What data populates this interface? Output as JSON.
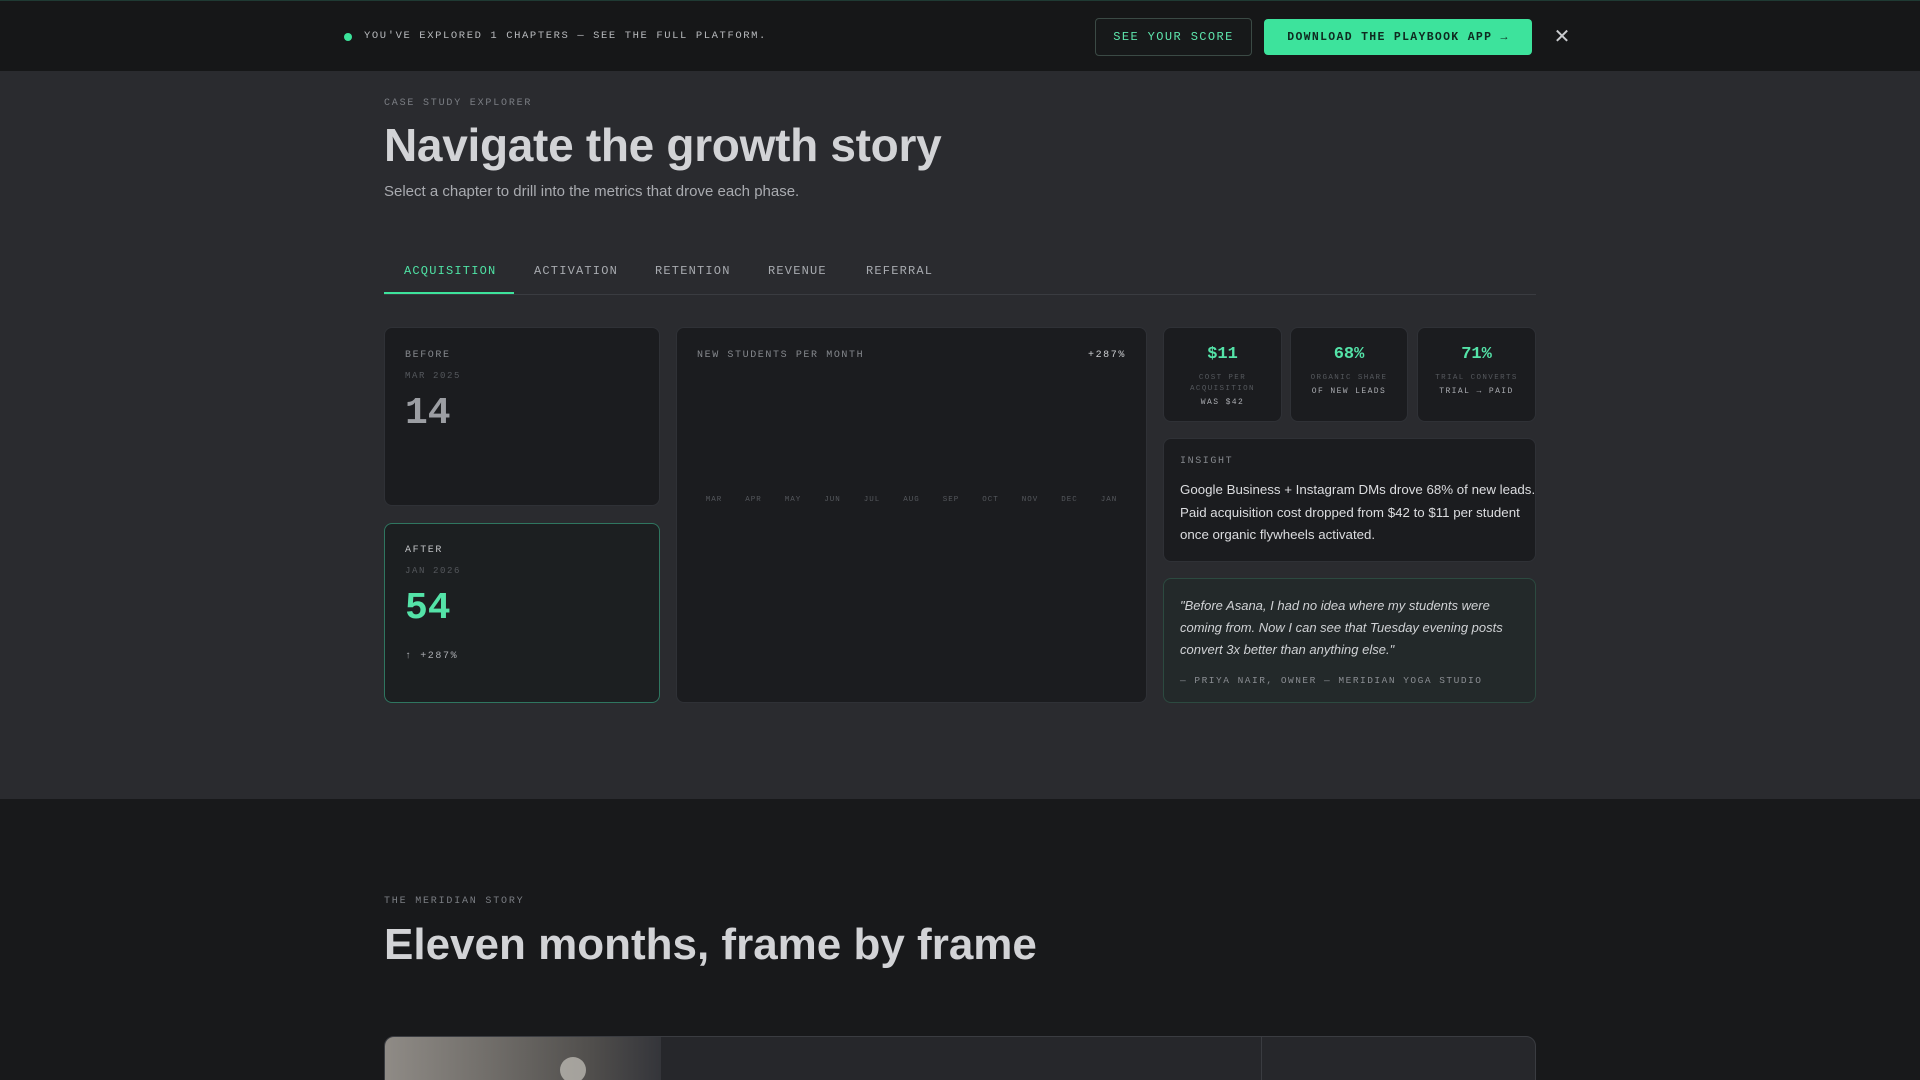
{
  "banner": {
    "message": "YOU'VE EXPLORED 1 CHAPTERS — SEE THE FULL PLATFORM.",
    "score_button": "SEE YOUR SCORE",
    "download_button": "DOWNLOAD THE PLAYBOOK APP →",
    "close_icon": "close-icon",
    "close_glyph": "✕"
  },
  "header": {
    "eyebrow": "CASE STUDY EXPLORER",
    "title": "Navigate the growth story",
    "subtitle": "Select a chapter to drill into the metrics that drove each phase."
  },
  "tabs": [
    {
      "label": "ACQUISITION",
      "active": true
    },
    {
      "label": "ACTIVATION",
      "active": false
    },
    {
      "label": "RETENTION",
      "active": false
    },
    {
      "label": "REVENUE",
      "active": false
    },
    {
      "label": "REFERRAL",
      "active": false
    }
  ],
  "before": {
    "label": "BEFORE",
    "date": "MAR 2025",
    "value": "14"
  },
  "after": {
    "label": "AFTER",
    "date": "JAN 2026",
    "value": "54",
    "delta": "↑ +287%"
  },
  "chart": {
    "title": "NEW STUDENTS PER MONTH",
    "badge": "+287%"
  },
  "chart_data": {
    "type": "bar",
    "title": "NEW STUDENTS PER MONTH",
    "categories": [
      "MAR",
      "APR",
      "MAY",
      "JUN",
      "JUL",
      "AUG",
      "SEP",
      "OCT",
      "NOV",
      "DEC",
      "JAN"
    ],
    "values": [],
    "annotations": [
      "+287%"
    ]
  },
  "stats": [
    {
      "value": "$11",
      "label": "COST PER ACQUISITION",
      "sub": "WAS $42"
    },
    {
      "value": "68%",
      "label": "ORGANIC SHARE",
      "sub": "OF NEW LEADS"
    },
    {
      "value": "71%",
      "label": "TRIAL CONVERTS",
      "sub": "TRIAL → PAID"
    }
  ],
  "insight": {
    "label": "INSIGHT",
    "text": "Google Business + Instagram DMs drove 68% of new leads. Paid acquisition cost dropped from $42 to $11 per student once organic flywheels activated."
  },
  "quote": {
    "text": "\"Before Asana, I had no idea where my students were coming from. Now I can see that Tuesday evening posts convert 3x better than anything else.\"",
    "attribution": "— PRIYA NAIR, OWNER — MERIDIAN YOGA STUDIO"
  },
  "story": {
    "eyebrow": "THE MERIDIAN STORY",
    "title": "Eleven months, frame by frame"
  },
  "colors": {
    "accent": "#3de39c",
    "background": "#2a2b2f",
    "card": "#1b1c1f"
  }
}
